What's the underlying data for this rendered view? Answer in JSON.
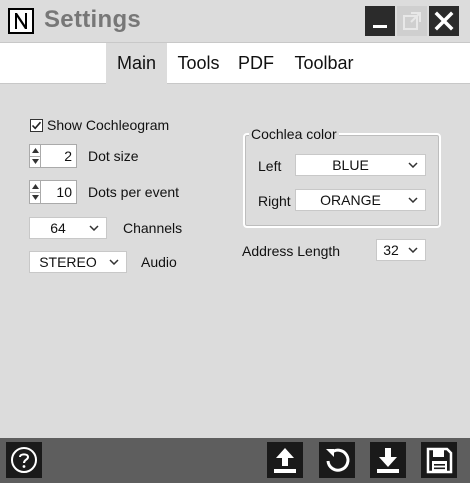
{
  "window": {
    "title": "Settings",
    "logo_letter": "N"
  },
  "tabs": [
    {
      "label": "Main",
      "active": true
    },
    {
      "label": "Tools",
      "active": false
    },
    {
      "label": "PDF",
      "active": false
    },
    {
      "label": "Toolbar",
      "active": false
    }
  ],
  "main": {
    "show_cochleogram": {
      "label": "Show Cochleogram",
      "checked": true
    },
    "dot_size": {
      "value": "2",
      "label": "Dot size"
    },
    "dots_per_event": {
      "value": "10",
      "label": "Dots per event"
    },
    "channels": {
      "value": "64",
      "label": "Channels"
    },
    "audio": {
      "value": "STEREO",
      "label": "Audio"
    },
    "cochlea_color": {
      "title": "Cochlea color",
      "left_label": "Left",
      "left_value": "BLUE",
      "right_label": "Right",
      "right_value": "ORANGE"
    },
    "address_length": {
      "label": "Address Length",
      "value": "32"
    }
  },
  "bottom_toolbar": {
    "icons": [
      "help-icon",
      "upload-icon",
      "reset-icon",
      "download-icon",
      "save-icon"
    ]
  },
  "colors": {
    "background": "#dcdcdc",
    "title_text": "#777777",
    "bottom_bar": "#5e5e5e",
    "button_dark": "#1a1a1a"
  }
}
